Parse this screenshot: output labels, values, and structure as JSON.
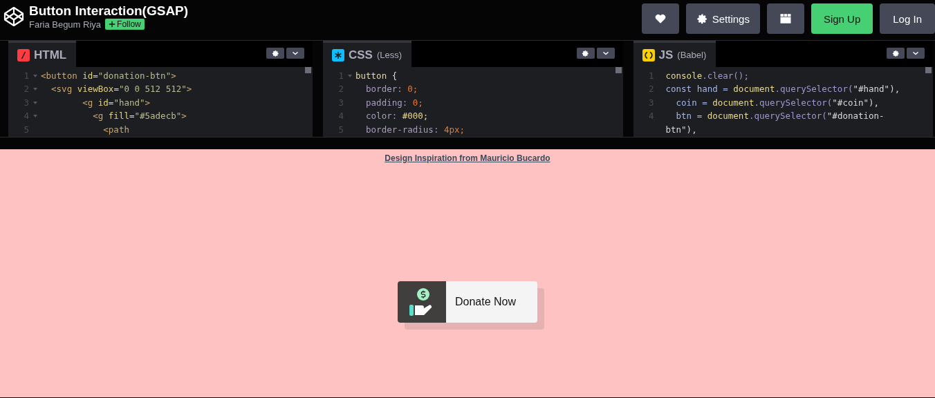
{
  "header": {
    "title": "Button Interaction(GSAP)",
    "author": "Faria Begum Riya",
    "follow": "Follow",
    "buttons": [
      {
        "kind": "heart"
      },
      {
        "kind": "settings",
        "label": "Settings"
      },
      {
        "kind": "layout"
      },
      {
        "kind": "signup",
        "label": "Sign Up"
      },
      {
        "kind": "login",
        "label": "Log In"
      }
    ]
  },
  "editors": [
    {
      "kind": "html",
      "name": "HTML",
      "lines": [
        {
          "num": "1",
          "fold": true,
          "tokens": [
            {
              "t": "<button ",
              "color": "#c8a46e"
            },
            {
              "t": "id",
              "color": "#e3d279"
            },
            {
              "t": "=",
              "color": "#d8d8d8"
            },
            {
              "t": "\"donation-btn\"",
              "color": "#b9bb8f"
            },
            {
              "t": ">",
              "color": "#c8a46e"
            }
          ]
        },
        {
          "num": "2",
          "fold": true,
          "tokens": [
            {
              "t": "  <svg ",
              "color": "#c8a46e"
            },
            {
              "t": "viewBox",
              "color": "#e3d279"
            },
            {
              "t": "=",
              "color": "#d8d8d8"
            },
            {
              "t": "\"0 0 512 512\"",
              "color": "#b9bb8f"
            },
            {
              "t": ">",
              "color": "#c8a46e"
            }
          ]
        },
        {
          "num": "3",
          "fold": true,
          "tokens": [
            {
              "t": "        <g ",
              "color": "#c8a46e"
            },
            {
              "t": "id",
              "color": "#e3d279"
            },
            {
              "t": "=",
              "color": "#d8d8d8"
            },
            {
              "t": "\"hand\"",
              "color": "#b9bb8f"
            },
            {
              "t": ">",
              "color": "#c8a46e"
            }
          ]
        },
        {
          "num": "4",
          "fold": true,
          "tokens": [
            {
              "t": "          <g ",
              "color": "#c8a46e"
            },
            {
              "t": "fill",
              "color": "#e3d279"
            },
            {
              "t": "=",
              "color": "#d8d8d8"
            },
            {
              "t": "\"#5adecb\"",
              "color": "#b9bb8f"
            },
            {
              "t": ">",
              "color": "#c8a46e"
            }
          ]
        },
        {
          "num": "5",
          "fold": false,
          "tokens": [
            {
              "t": "            <path",
              "color": "#c8a46e"
            }
          ]
        }
      ]
    },
    {
      "kind": "css",
      "name": "CSS",
      "sub": "(Less)",
      "lines": [
        {
          "num": "1",
          "fold": true,
          "tokens": [
            {
              "t": "button ",
              "color": "#e8d88a"
            },
            {
              "t": "{",
              "color": "#d8d8d8"
            }
          ]
        },
        {
          "num": "2",
          "fold": false,
          "tokens": [
            {
              "t": "  border: ",
              "color": "#a89cbf"
            },
            {
              "t": "0;",
              "color": "#e47b3a"
            }
          ]
        },
        {
          "num": "3",
          "fold": false,
          "tokens": [
            {
              "t": "  padding: ",
              "color": "#a89cbf"
            },
            {
              "t": "0;",
              "color": "#e47b3a"
            }
          ]
        },
        {
          "num": "4",
          "fold": false,
          "tokens": [
            {
              "t": "  color: ",
              "color": "#a89cbf"
            },
            {
              "t": "#000;",
              "color": "#e8d88a"
            }
          ]
        },
        {
          "num": "5",
          "fold": false,
          "tokens": [
            {
              "t": "  border-radius: ",
              "color": "#a89cbf"
            },
            {
              "t": "4px;",
              "color": "#e47b3a"
            }
          ]
        }
      ]
    },
    {
      "kind": "js",
      "name": "JS",
      "sub": "(Babel)",
      "lines": [
        {
          "num": "1",
          "fold": false,
          "tokens": [
            {
              "t": "console",
              "color": "#e8d88a"
            },
            {
              "t": ".clear();",
              "color": "#9d97d1"
            }
          ]
        },
        {
          "num": "2",
          "fold": false,
          "tokens": [
            {
              "t": "const hand = ",
              "color": "#a3b5e3"
            },
            {
              "t": "document",
              "color": "#e8d88a"
            },
            {
              "t": ".querySelector(",
              "color": "#9d97d1"
            },
            {
              "t": "\"#hand\"),",
              "color": "#d8d8d8"
            }
          ]
        },
        {
          "num": "3",
          "fold": false,
          "tokens": [
            {
              "t": "  coin = ",
              "color": "#a3b5e3"
            },
            {
              "t": "document",
              "color": "#e8d88a"
            },
            {
              "t": ".querySelector(",
              "color": "#9d97d1"
            },
            {
              "t": "\"#coin\"),",
              "color": "#d8d8d8"
            }
          ]
        },
        {
          "num": "4",
          "fold": false,
          "tokens": [
            {
              "t": "  btn = ",
              "color": "#a3b5e3"
            },
            {
              "t": "document",
              "color": "#e8d88a"
            },
            {
              "t": ".querySelector(",
              "color": "#9d97d1"
            },
            {
              "t": "\"#donation-",
              "color": "#d8d8d8"
            }
          ]
        },
        {
          "fold": false,
          "tokens": [
            {
              "t": "btn\"),",
              "color": "#d8d8d8"
            }
          ]
        }
      ]
    }
  ],
  "preview": {
    "link": "Design Inspiration from Mauricio Bucardo",
    "donate": "Donate Now"
  }
}
